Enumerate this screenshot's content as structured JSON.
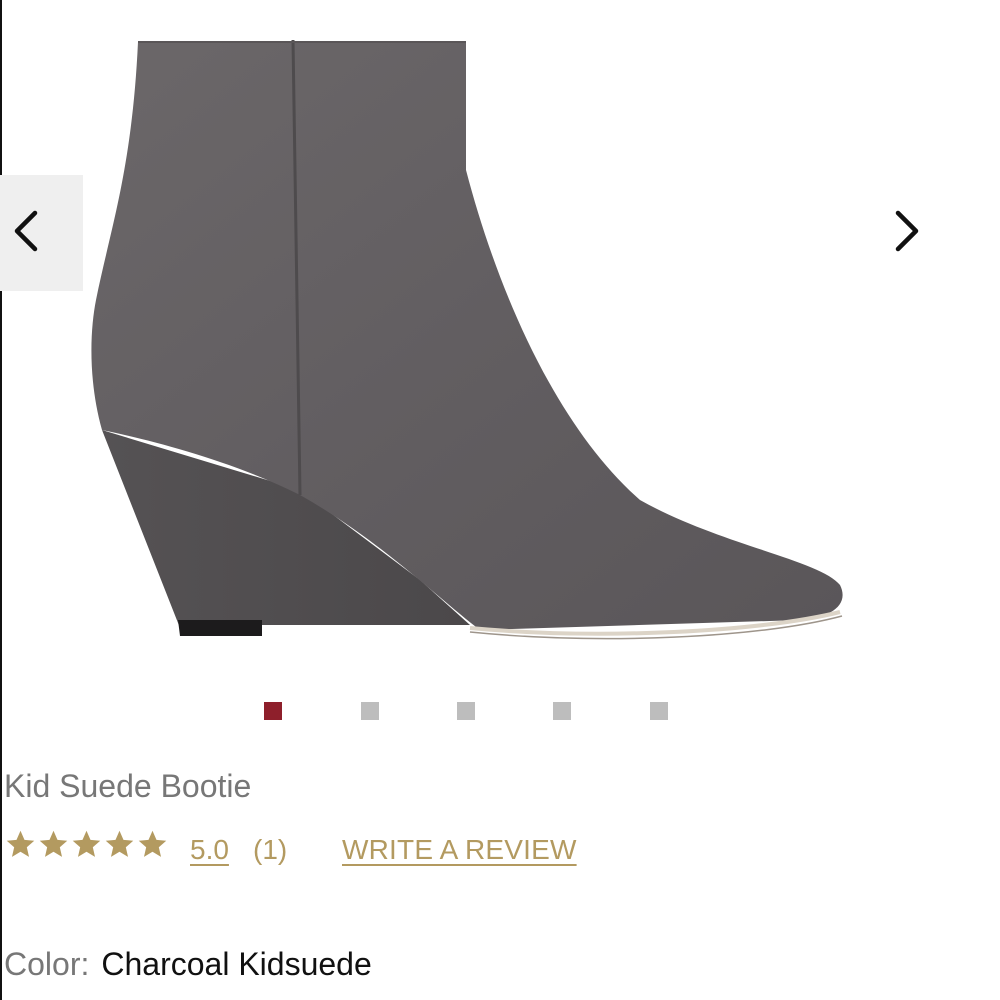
{
  "product": {
    "name": "Kid Suede Bootie",
    "rating": "5.0",
    "stars": 5,
    "max_stars": 5,
    "review_count": "(1)",
    "write_review_label": "WRITE A REVIEW",
    "color_label": "Color:",
    "color_value": "Charcoal Kidsuede"
  },
  "carousel": {
    "total_images": 5,
    "active_index": 0,
    "prev_icon": "chevron-left-icon",
    "next_icon": "chevron-right-icon"
  },
  "colors": {
    "accent_gold": "#b39a60",
    "active_dot": "#8e1f2b",
    "inactive_dot": "#bdbdbd"
  }
}
